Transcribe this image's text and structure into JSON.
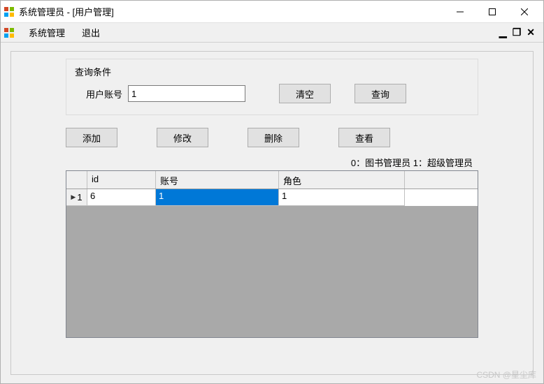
{
  "window": {
    "title": "系统管理员 - [用户管理]"
  },
  "menubar": {
    "system": "系统管理",
    "exit": "退出"
  },
  "query": {
    "group_title": "查询条件",
    "account_label": "用户账号",
    "account_value": "1",
    "clear_label": "清空",
    "search_label": "查询"
  },
  "actions": {
    "add": "添加",
    "edit": "修改",
    "delete": "删除",
    "view": "查看"
  },
  "legend": "0：图书管理员  1：超级管理员",
  "grid": {
    "columns": {
      "id": "id",
      "account": "账号",
      "role": "角色"
    },
    "row_number": "1",
    "rows": [
      {
        "id": "6",
        "account": "1",
        "role": "1"
      }
    ]
  },
  "watermark": "CSDN @星尘库"
}
